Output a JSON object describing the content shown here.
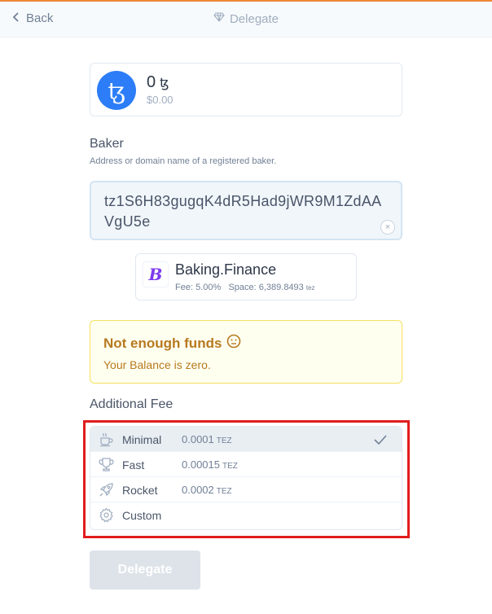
{
  "header": {
    "back_label": "Back",
    "title": "Delegate"
  },
  "account": {
    "balance": "0",
    "balance_symbol": "ꜩ",
    "balance_usd": "$0.00"
  },
  "baker": {
    "label": "Baker",
    "description": "Address or domain name of a registered baker.",
    "address": "tz1S6H83gugqK4dR5Had9jWR9M1ZdAAVgU5e",
    "clear_icon": "×",
    "card": {
      "name": "Baking.Finance",
      "fee_text": "Fee: 5.00%",
      "space_text": "Space: 6,389.8493",
      "space_unit": "tez"
    }
  },
  "alert": {
    "title": "Not enough funds",
    "text": "Your Balance is zero."
  },
  "fee": {
    "label": "Additional Fee",
    "options": [
      {
        "name": "Minimal",
        "amount": "0.0001",
        "unit": "TEZ",
        "icon": "coffee-icon",
        "selected": true
      },
      {
        "name": "Fast",
        "amount": "0.00015",
        "unit": "TEZ",
        "icon": "trophy-icon",
        "selected": false
      },
      {
        "name": "Rocket",
        "amount": "0.0002",
        "unit": "TEZ",
        "icon": "rocket-icon",
        "selected": false
      },
      {
        "name": "Custom",
        "amount": "",
        "unit": "",
        "icon": "gear-icon",
        "selected": false
      }
    ]
  },
  "action": {
    "delegate_label": "Delegate"
  },
  "colors": {
    "accent": "#ed8936",
    "tezos_blue": "#2c7df7",
    "warning_text": "#b7791f",
    "highlight_red": "#e11d1d"
  }
}
